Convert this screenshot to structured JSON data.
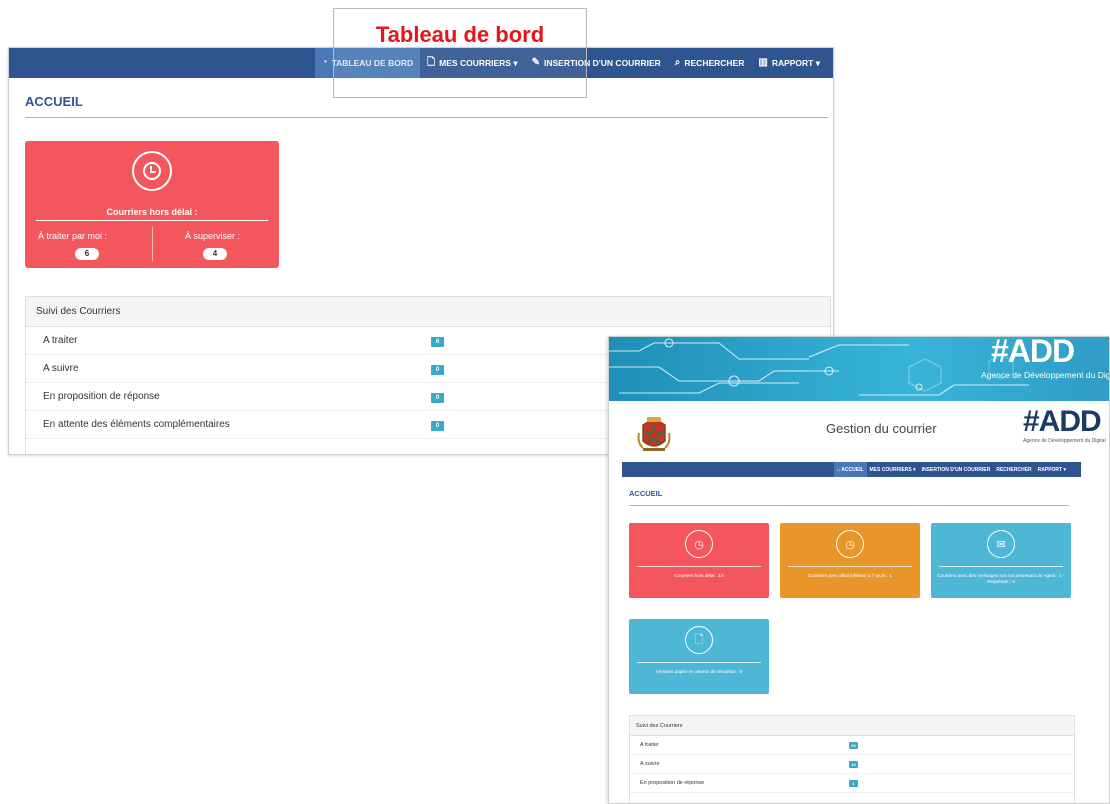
{
  "callout": {
    "label": "Tableau de bord"
  },
  "screen_large": {
    "nav": [
      {
        "icon": "dashboard-icon",
        "glyph": "◔",
        "label": "TABLEAU DE BORD",
        "active": true
      },
      {
        "icon": "file-icon",
        "glyph": "🗋",
        "label": "MES COURRIERS ▾",
        "active": false
      },
      {
        "icon": "edit-icon",
        "glyph": "✎",
        "label": "INSERTION D'UN COURRIER",
        "active": false
      },
      {
        "icon": "search-icon",
        "glyph": "⌕",
        "label": "RECHERCHER",
        "active": false
      },
      {
        "icon": "chart-icon",
        "glyph": "▥",
        "label": "RAPPORT ▾",
        "active": false
      }
    ],
    "page_title": "ACCUEIL",
    "overdue_card": {
      "title": "Courriers hors délai :",
      "left_label": "À traiter par moi :",
      "left_value": "6",
      "right_label": "À superviser :",
      "right_value": "4",
      "color": "#f3565d"
    },
    "tracking": {
      "title": "Suivi des Courriers",
      "rows": [
        {
          "label": "A traiter",
          "value": "6"
        },
        {
          "label": "A suivre",
          "value": "0"
        },
        {
          "label": "En proposition de réponse",
          "value": "0"
        },
        {
          "label": "En attente des éléments complémentaires",
          "value": "0"
        }
      ]
    }
  },
  "screen_small": {
    "agency_logo": "#ADD",
    "agency_name": "Agence de Développement du Digital",
    "header_title": "Gestion du courrier",
    "nav": [
      {
        "label": "⌂ ACCUEIL",
        "active": true
      },
      {
        "label": "MES COURRIERS ▾",
        "active": false
      },
      {
        "label": "INSERTION D'UN COURRIER",
        "active": false
      },
      {
        "label": "RECHERCHER",
        "active": false
      },
      {
        "label": "RAPPORT ▾",
        "active": false
      }
    ],
    "page_title": "ACCUEIL",
    "cards": [
      {
        "icon": "clock-icon",
        "glyph": "◷",
        "text": "Courriers hors délai : 10",
        "color": "#f3565d"
      },
      {
        "icon": "clock-icon",
        "glyph": "◷",
        "text": "Courriers avec délai inférieur à 7 jours : 1",
        "color": "#e8952a"
      },
      {
        "icon": "mail-icon",
        "glyph": "✉",
        "text": "Courriers avec des messages non lus provenant de Agent : 1 - Requérant : 0",
        "color": "#4fb7d6"
      },
      {
        "icon": "file-icon",
        "glyph": "🗋",
        "text": "Versions papier en attente de réception : 8",
        "color": "#4fb7d6"
      }
    ],
    "tracking": {
      "title": "Suivi des Courriers",
      "rows": [
        {
          "label": "A traiter",
          "value": "20"
        },
        {
          "label": "A suivre",
          "value": "24"
        },
        {
          "label": "En proposition de réponse",
          "value": "1"
        }
      ]
    }
  }
}
